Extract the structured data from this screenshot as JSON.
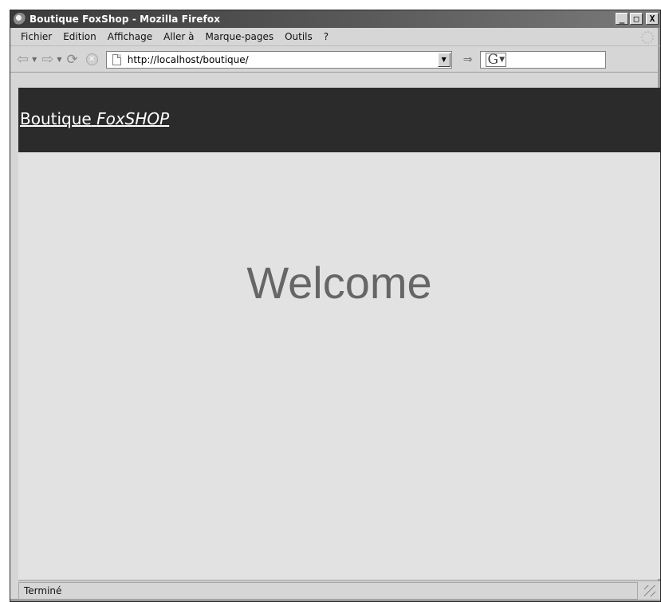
{
  "window": {
    "title": "Boutique FoxShop - Mozilla Firefox",
    "buttons": {
      "minimize": "_",
      "maximize": "□",
      "close": "X"
    }
  },
  "menubar": {
    "items": [
      {
        "label": "Fichier"
      },
      {
        "label": "Edition"
      },
      {
        "label": "Affichage"
      },
      {
        "label": "Aller à"
      },
      {
        "label": "Marque-pages"
      },
      {
        "label": "Outils"
      },
      {
        "label": "?"
      }
    ]
  },
  "toolbar": {
    "back_icon": "back-arrow-icon",
    "forward_icon": "forward-arrow-icon",
    "reload_icon": "reload-icon",
    "stop_icon": "stop-icon",
    "url": "http://localhost/boutique/",
    "go_icon": "go-icon",
    "search_engine": "G"
  },
  "page": {
    "brand_prefix": "Boutique",
    "brand_name": "FoxSHOP",
    "welcome": "Welcome",
    "header_bg": "#2b2b2b",
    "body_bg": "#e2e2e2"
  },
  "statusbar": {
    "text": "Terminé"
  }
}
